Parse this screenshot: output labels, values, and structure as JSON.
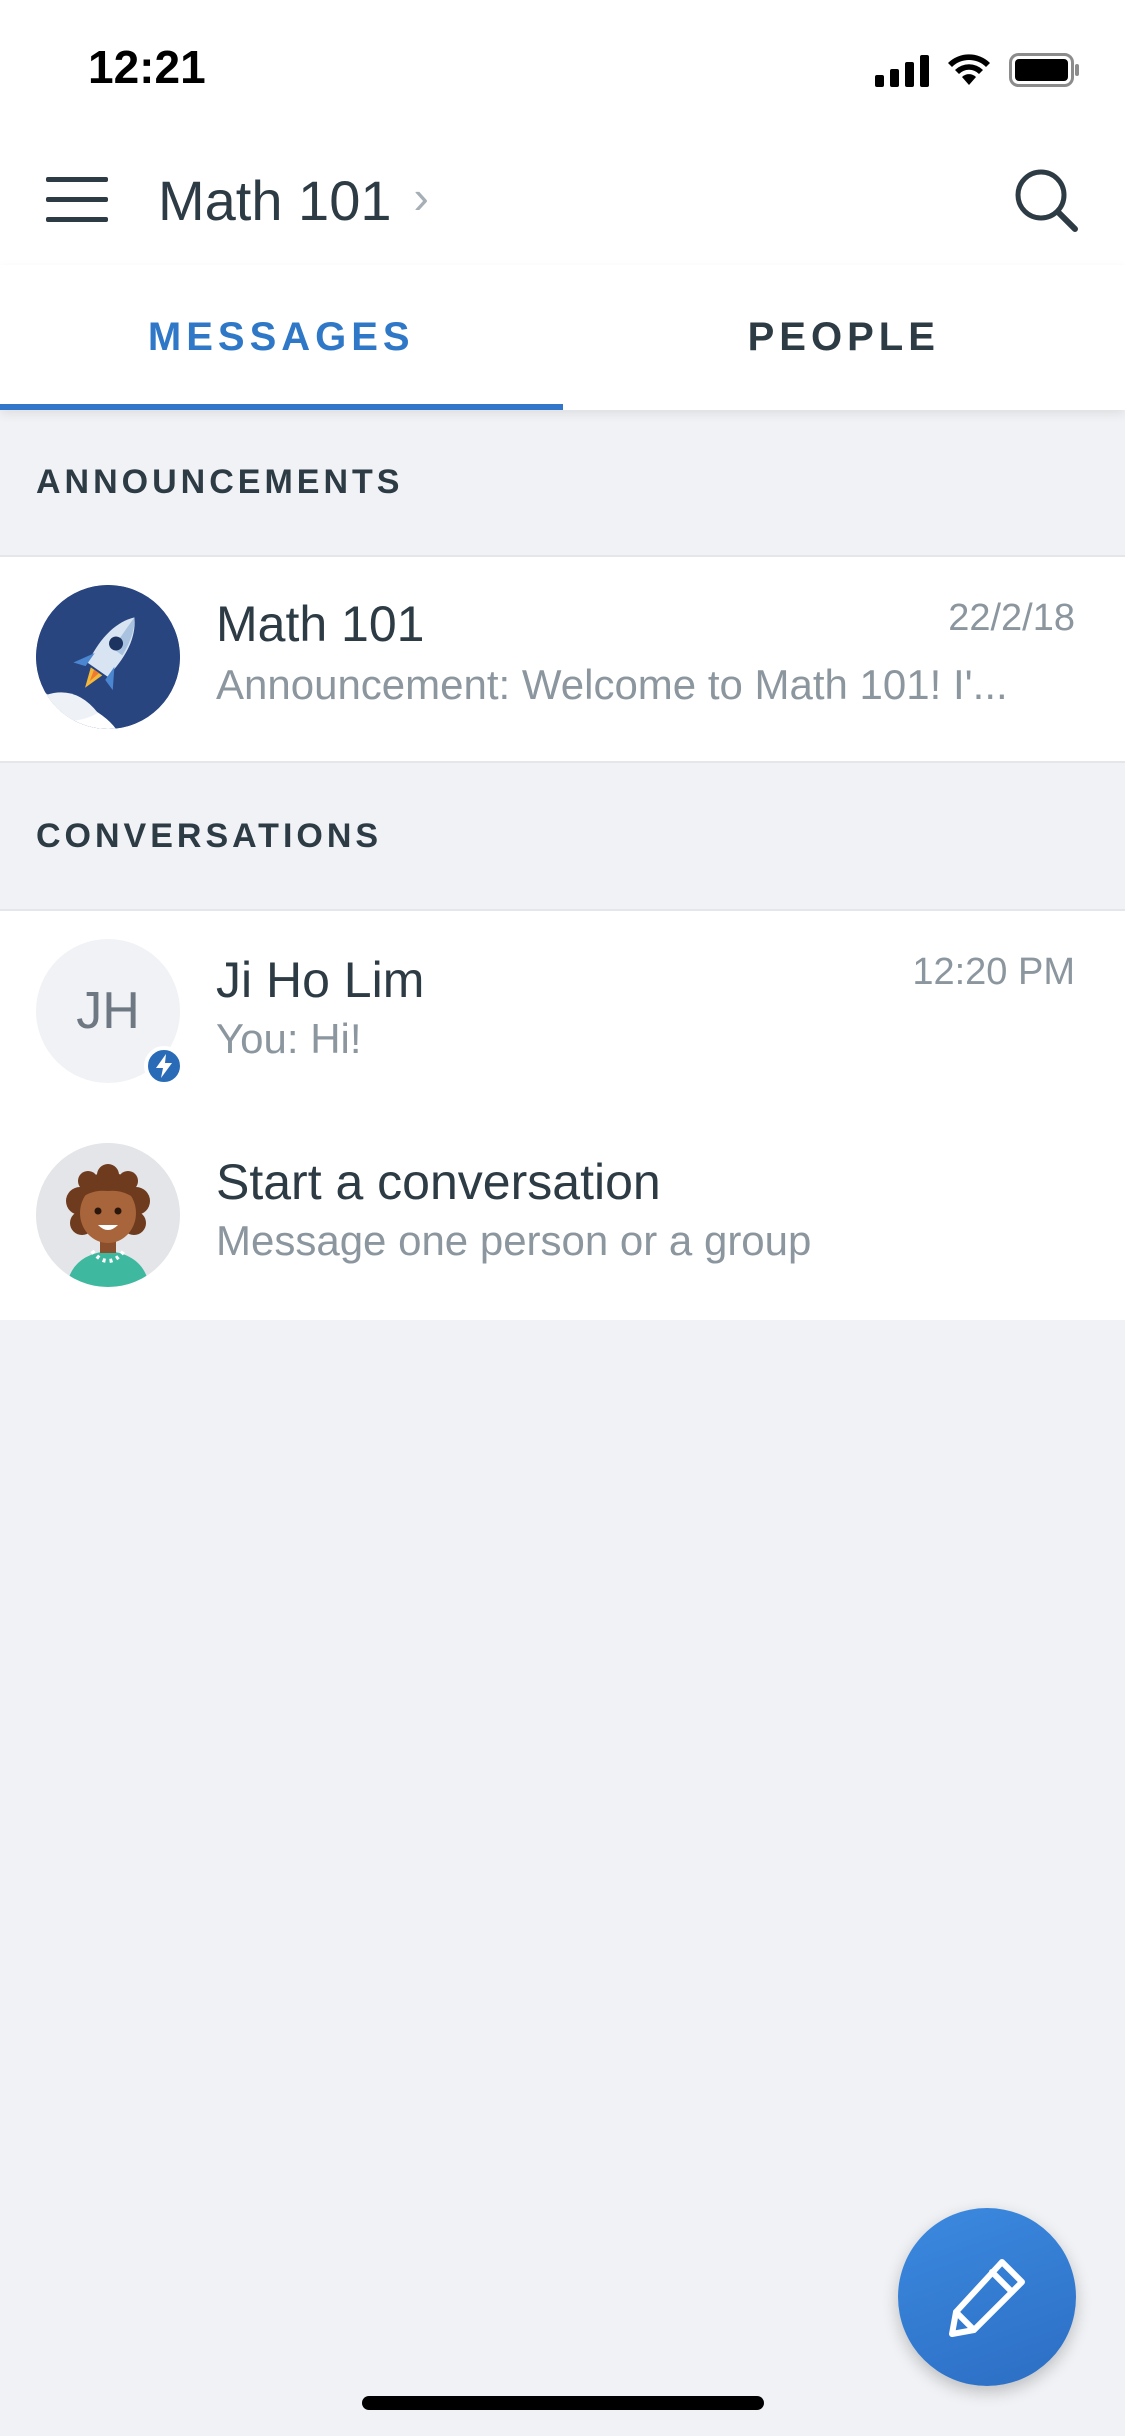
{
  "status_bar": {
    "time": "12:21"
  },
  "header": {
    "title": "Math 101"
  },
  "tabs": [
    {
      "label": "MESSAGES",
      "active": true
    },
    {
      "label": "PEOPLE",
      "active": false
    }
  ],
  "sections": {
    "announcements": {
      "label": "ANNOUNCEMENTS"
    },
    "conversations": {
      "label": "CONVERSATIONS"
    }
  },
  "announcement_item": {
    "title": "Math 101",
    "preview": "Announcement: Welcome to Math 101! I'...",
    "date": "22/2/18"
  },
  "conversation_item": {
    "initials": "JH",
    "name": "Ji Ho Lim",
    "preview": "You: Hi!",
    "time": "12:20 PM"
  },
  "start_conversation": {
    "title": "Start a conversation",
    "subtitle": "Message one person or a group"
  },
  "colors": {
    "accent": "#2f78c7",
    "background": "#f0f2f5",
    "text": "#2d3b45",
    "muted": "#8b969e"
  },
  "icons": {
    "menu": "hamburger-icon",
    "search": "search-icon",
    "chevron": "chevron-right-icon",
    "announcement_avatar": "rocket-icon",
    "badge": "lightning-icon",
    "start_avatar": "person-avatar-icon",
    "fab": "pencil-icon"
  }
}
